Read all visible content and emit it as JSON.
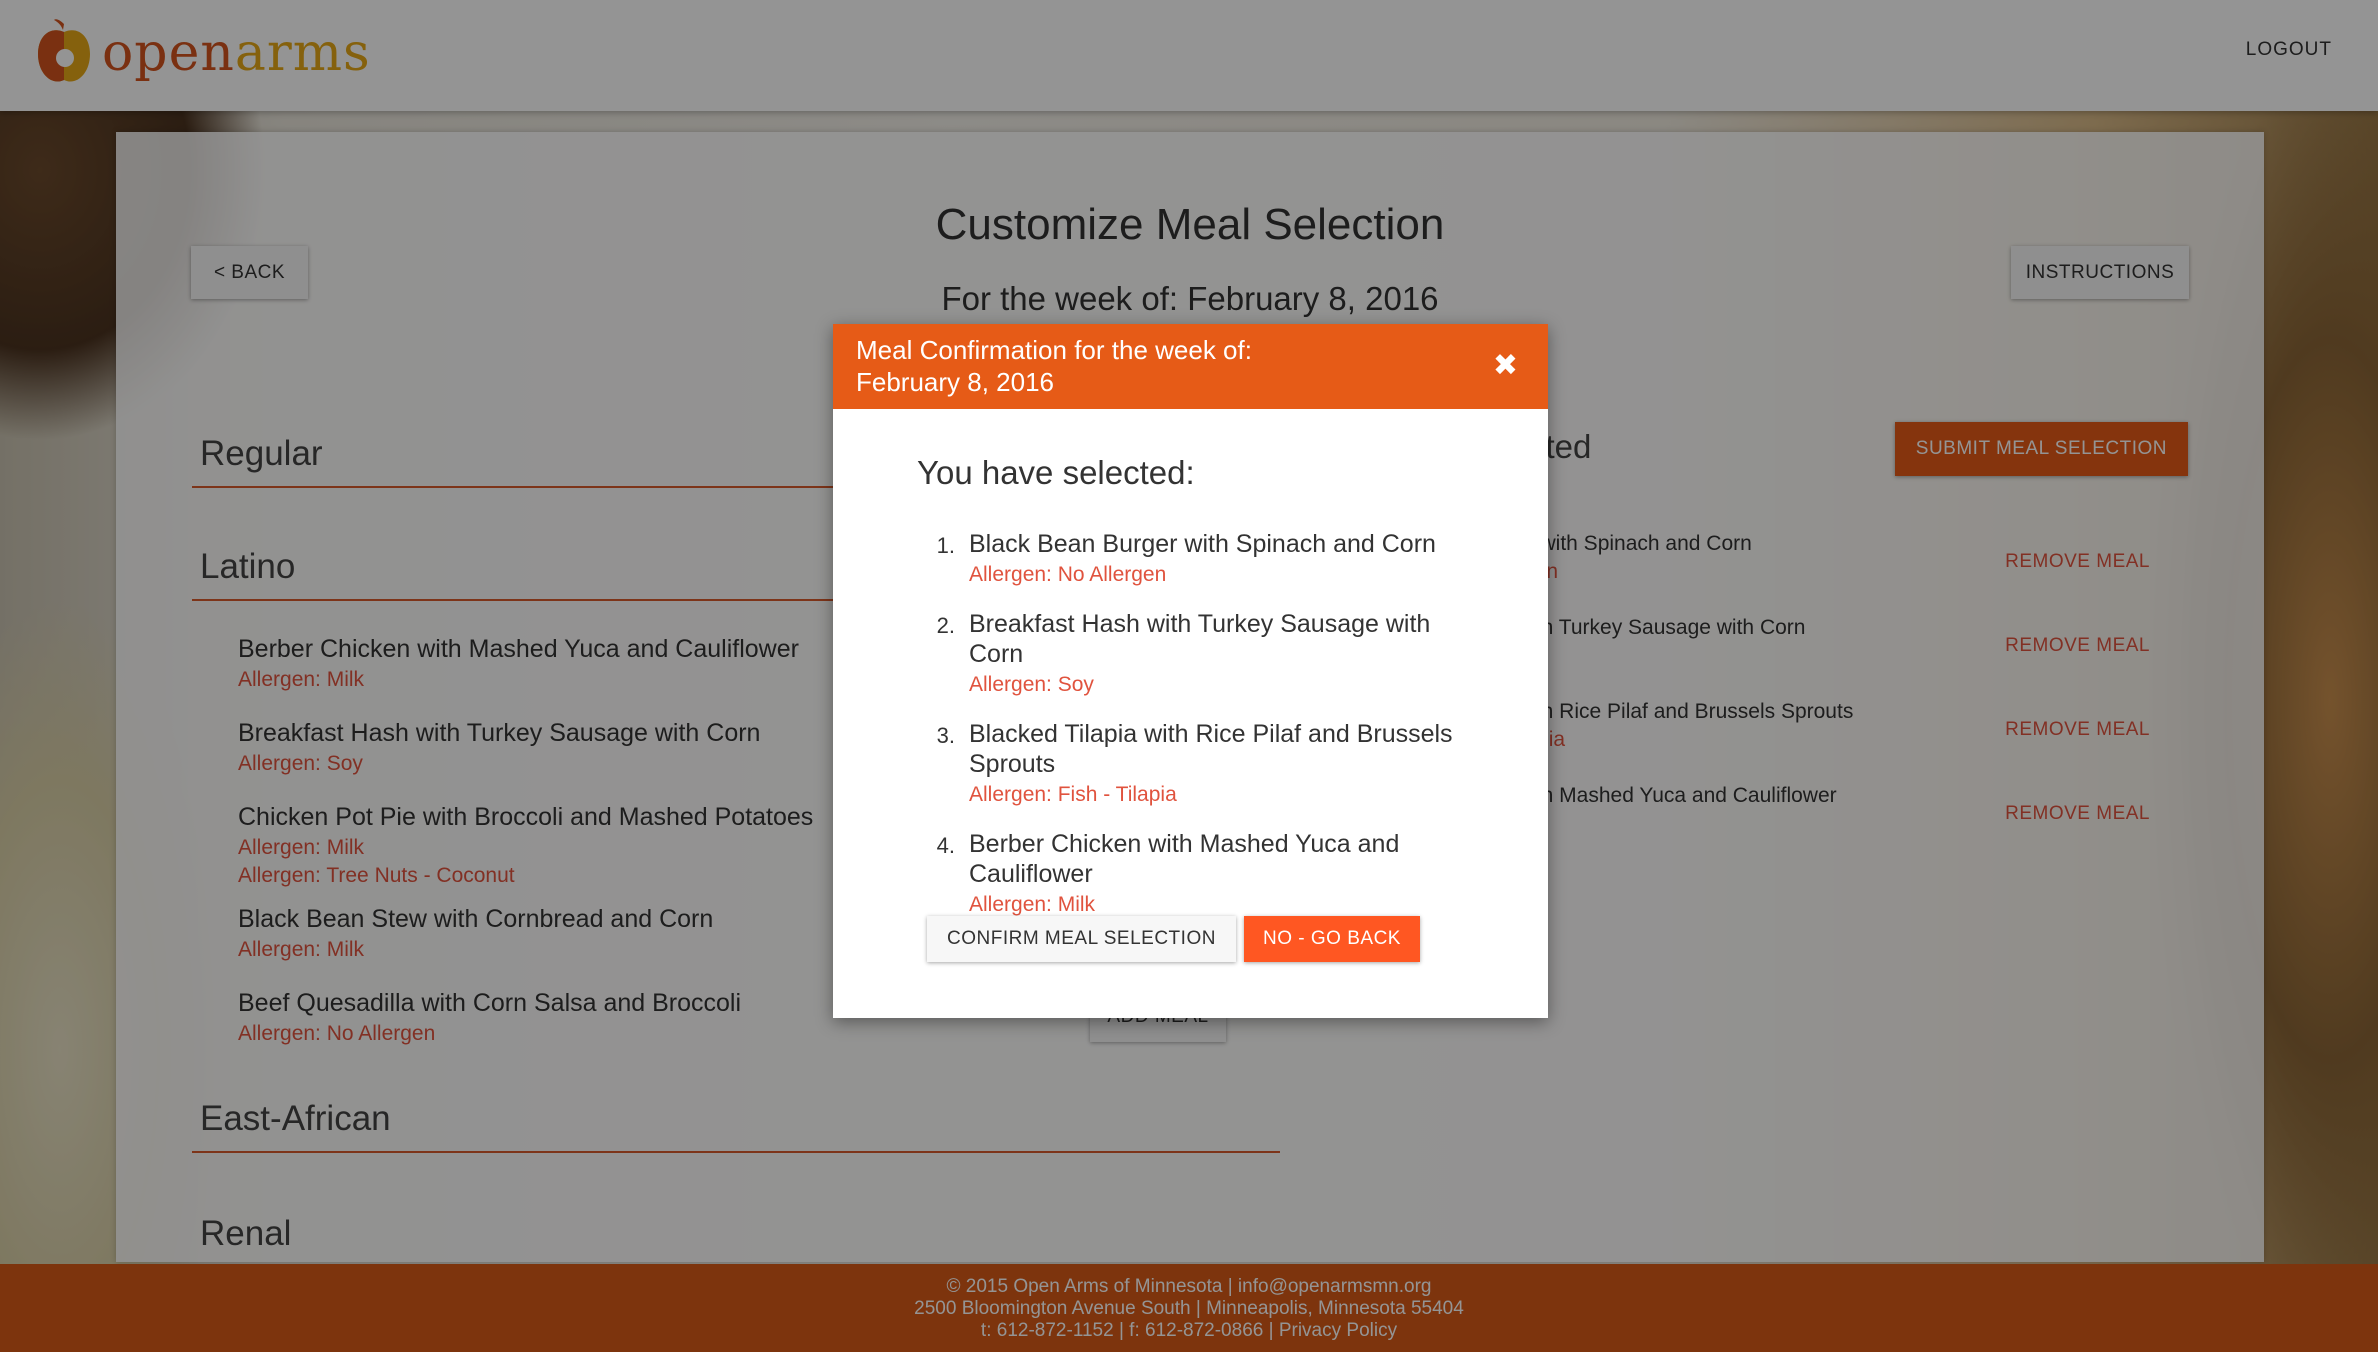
{
  "header": {
    "logo_open": "open",
    "logo_arms": "arms",
    "logout_label": "LOGOUT"
  },
  "page": {
    "back_label": "< BACK",
    "instructions_label": "INSTRUCTIONS",
    "title": "Customize Meal Selection",
    "subtitle": "For the week of: February 8, 2016",
    "submit_label": "SUBMIT MEAL SELECTION"
  },
  "sections": {
    "regular": "Regular",
    "latino": "Latino",
    "east_african": "East-African",
    "renal": "Renal"
  },
  "latino_meals": [
    {
      "name": "Berber Chicken with Mashed Yuca and Cauliflower",
      "allergens": [
        "Allergen: Milk"
      ]
    },
    {
      "name": "Breakfast Hash with Turkey Sausage with Corn",
      "allergens": [
        "Allergen: Soy"
      ]
    },
    {
      "name": "Chicken Pot Pie with Broccoli and Mashed Potatoes",
      "allergens": [
        "Allergen: Milk",
        "Allergen: Tree Nuts - Coconut"
      ]
    },
    {
      "name": "Black Bean Stew with Cornbread and Corn",
      "allergens": [
        "Allergen: Milk"
      ]
    },
    {
      "name": "Beef Quesadilla with Corn Salsa and Broccoli",
      "allergens": [
        "Allergen: No Allergen"
      ]
    }
  ],
  "add_meal_label": "ADD MEAL",
  "selected_panel": {
    "heading_partial": "cted",
    "items": [
      {
        "name": "er with Spinach and Corn",
        "allergen": "rgen"
      },
      {
        "name": "with Turkey Sausage with Corn",
        "allergen": ""
      },
      {
        "name": "with Rice Pilaf and Brussels Sprouts",
        "allergen": "ilapia"
      },
      {
        "name": "with Mashed Yuca and Cauliflower",
        "allergen": ""
      }
    ],
    "remove_label": "REMOVE MEAL"
  },
  "modal": {
    "title_line1": "Meal Confirmation for the week of:",
    "title_line2": "February 8, 2016",
    "close_glyph": "✖",
    "heading": "You have selected:",
    "items": [
      {
        "num": "1.",
        "name": "Black Bean Burger with Spinach and Corn",
        "allergen": "Allergen: No Allergen"
      },
      {
        "num": "2.",
        "name": "Breakfast Hash with Turkey Sausage with Corn",
        "allergen": "Allergen: Soy"
      },
      {
        "num": "3.",
        "name": "Blacked Tilapia with Rice Pilaf and Brussels Sprouts",
        "allergen": "Allergen: Fish - Tilapia"
      },
      {
        "num": "4.",
        "name": "Berber Chicken with Mashed Yuca and Cauliflower",
        "allergen": "Allergen: Milk"
      }
    ],
    "confirm_label": "CONFIRM MEAL SELECTION",
    "go_back_label": "NO - GO BACK"
  },
  "footer": {
    "line1": "© 2015 Open Arms of Minnesota | info@openarmsmn.org",
    "line2": "2500 Bloomington Avenue South | Minneapolis, Minnesota 55404",
    "line3_phone": "t: 612-872-1152 | f: 612-872-0866 | ",
    "privacy_label": "Privacy Policy"
  },
  "colors": {
    "brand_orange": "#e65b17",
    "allergen_red": "#e0533e",
    "logo_yellow": "#e6a817"
  },
  "icons": {
    "logo": "apple-logo-icon",
    "close": "close-icon"
  }
}
